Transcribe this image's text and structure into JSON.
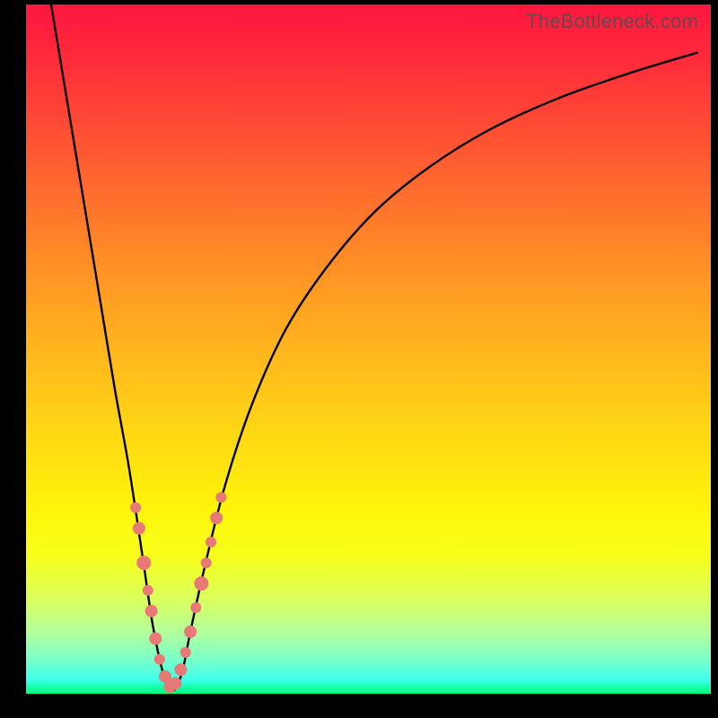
{
  "watermark": "TheBottleneck.com",
  "chart_data": {
    "type": "line",
    "title": "",
    "xlabel": "",
    "ylabel": "",
    "xlim": [
      0,
      100
    ],
    "ylim": [
      0,
      100
    ],
    "grid": false,
    "gradient_bands": [
      {
        "color": "#ff163f",
        "pos": 0
      },
      {
        "color": "#ff8a27",
        "pos": 36
      },
      {
        "color": "#fff40a",
        "pos": 73
      },
      {
        "color": "#00ff77",
        "pos": 100
      }
    ],
    "series": [
      {
        "name": "bottleneck-curve",
        "x": [
          3,
          5,
          7,
          9,
          11,
          13,
          15,
          17,
          18.5,
          20,
          21,
          22,
          23,
          24,
          26,
          29,
          33,
          38,
          44,
          51,
          59,
          68,
          78,
          88,
          98
        ],
        "y": [
          104,
          92,
          80,
          68,
          56,
          44,
          33,
          20,
          10,
          3,
          0.5,
          1,
          4,
          9,
          18,
          30,
          42,
          53,
          62,
          70,
          76.5,
          82,
          86.5,
          90,
          93
        ]
      }
    ],
    "markers": [
      {
        "x": 16.0,
        "y": 27.0,
        "r": 6
      },
      {
        "x": 16.5,
        "y": 24.0,
        "r": 7
      },
      {
        "x": 17.2,
        "y": 19.0,
        "r": 8
      },
      {
        "x": 17.8,
        "y": 15.0,
        "r": 6
      },
      {
        "x": 18.3,
        "y": 12.0,
        "r": 7
      },
      {
        "x": 18.9,
        "y": 8.0,
        "r": 7
      },
      {
        "x": 19.5,
        "y": 5.0,
        "r": 6
      },
      {
        "x": 20.3,
        "y": 2.5,
        "r": 7
      },
      {
        "x": 21.0,
        "y": 1.0,
        "r": 7
      },
      {
        "x": 21.8,
        "y": 1.5,
        "r": 7
      },
      {
        "x": 22.6,
        "y": 3.5,
        "r": 7
      },
      {
        "x": 23.3,
        "y": 6.0,
        "r": 6
      },
      {
        "x": 24.0,
        "y": 9.0,
        "r": 7
      },
      {
        "x": 24.8,
        "y": 12.5,
        "r": 6
      },
      {
        "x": 25.6,
        "y": 16.0,
        "r": 8
      },
      {
        "x": 26.3,
        "y": 19.0,
        "r": 6
      },
      {
        "x": 27.0,
        "y": 22.0,
        "r": 6
      },
      {
        "x": 27.8,
        "y": 25.5,
        "r": 7
      },
      {
        "x": 28.5,
        "y": 28.5,
        "r": 6
      }
    ],
    "marker_color": "#e77a77",
    "curve_color": "#000000"
  }
}
